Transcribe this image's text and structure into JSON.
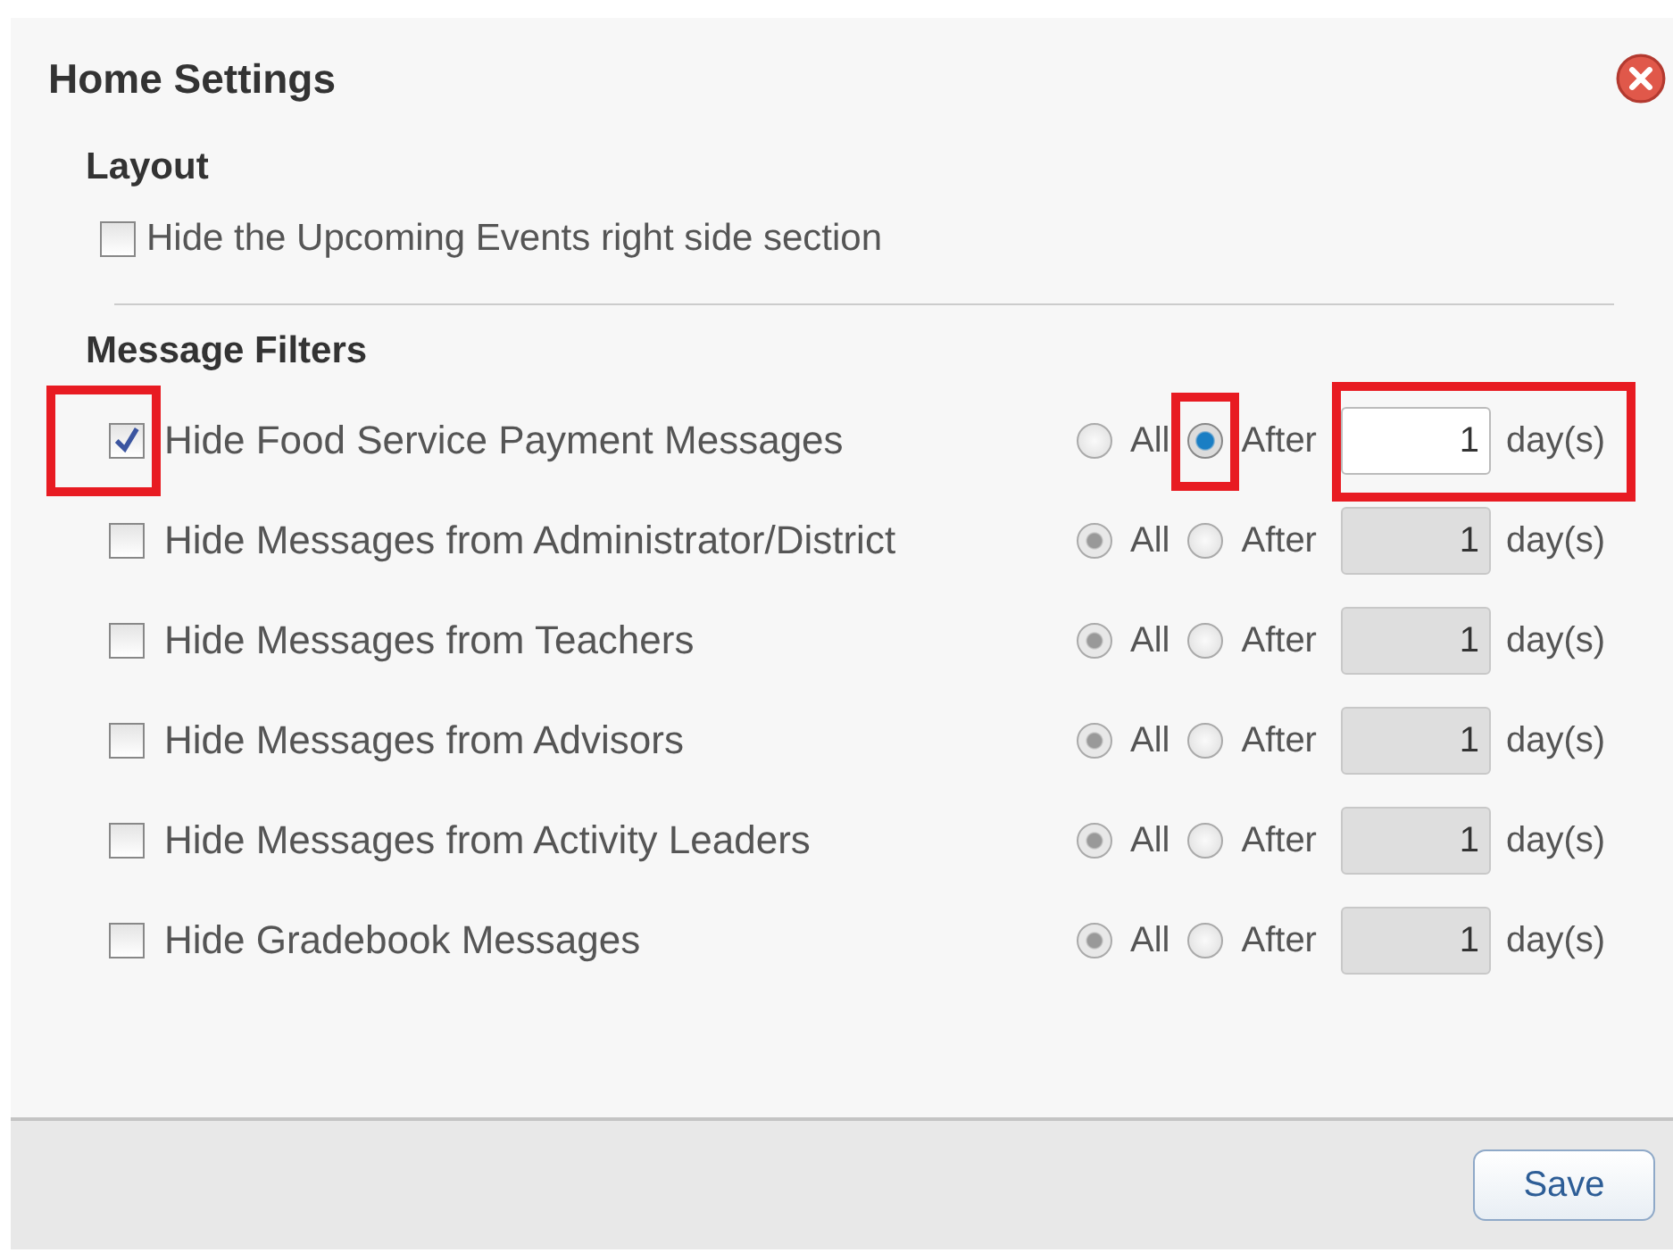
{
  "dialog": {
    "title": "Home Settings"
  },
  "layout": {
    "heading": "Layout",
    "option": {
      "label": "Hide the Upcoming Events right side section",
      "checked": false
    }
  },
  "message_filters": {
    "heading": "Message Filters",
    "rows": [
      {
        "label": "Hide Food Service Payment Messages",
        "checked": true,
        "checkbox_highlighted": true,
        "options": [
          {
            "label": "All",
            "selected": false,
            "highlighted": false
          },
          {
            "label": "After",
            "selected": true,
            "highlighted": true
          }
        ],
        "days": {
          "value": "1",
          "disabled": false,
          "unit": "day(s)",
          "highlighted": true
        }
      },
      {
        "label": "Hide Messages from Administrator/District",
        "checked": false,
        "checkbox_highlighted": false,
        "options": [
          {
            "label": "All",
            "selected": true,
            "highlighted": false
          },
          {
            "label": "After",
            "selected": false,
            "highlighted": false
          }
        ],
        "days": {
          "value": "1",
          "disabled": true,
          "unit": "day(s)",
          "highlighted": false
        }
      },
      {
        "label": "Hide Messages from Teachers",
        "checked": false,
        "checkbox_highlighted": false,
        "options": [
          {
            "label": "All",
            "selected": true,
            "highlighted": false
          },
          {
            "label": "After",
            "selected": false,
            "highlighted": false
          }
        ],
        "days": {
          "value": "1",
          "disabled": true,
          "unit": "day(s)",
          "highlighted": false
        }
      },
      {
        "label": "Hide Messages from Advisors",
        "checked": false,
        "checkbox_highlighted": false,
        "options": [
          {
            "label": "All",
            "selected": true,
            "highlighted": false
          },
          {
            "label": "After",
            "selected": false,
            "highlighted": false
          }
        ],
        "days": {
          "value": "1",
          "disabled": true,
          "unit": "day(s)",
          "highlighted": false
        }
      },
      {
        "label": "Hide Messages from Activity Leaders",
        "checked": false,
        "checkbox_highlighted": false,
        "options": [
          {
            "label": "All",
            "selected": true,
            "highlighted": false
          },
          {
            "label": "After",
            "selected": false,
            "highlighted": false
          }
        ],
        "days": {
          "value": "1",
          "disabled": true,
          "unit": "day(s)",
          "highlighted": false
        }
      },
      {
        "label": "Hide Gradebook Messages",
        "checked": false,
        "checkbox_highlighted": false,
        "options": [
          {
            "label": "All",
            "selected": true,
            "highlighted": false
          },
          {
            "label": "After",
            "selected": false,
            "highlighted": false
          }
        ],
        "days": {
          "value": "1",
          "disabled": true,
          "unit": "day(s)",
          "highlighted": false
        }
      }
    ]
  },
  "footer": {
    "button": "Save"
  }
}
